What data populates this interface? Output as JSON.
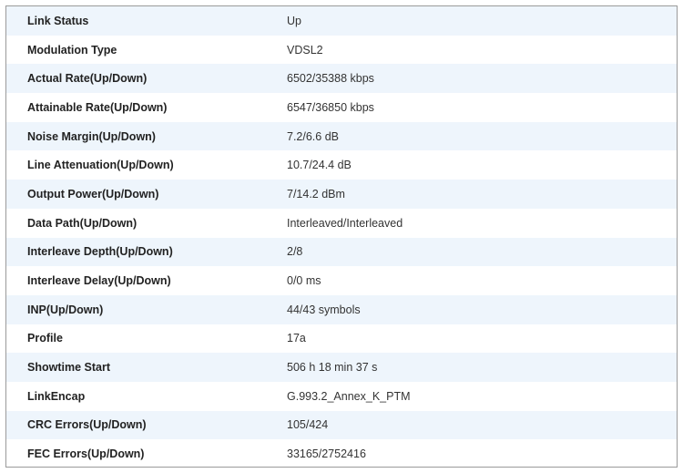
{
  "rows": [
    {
      "label": "Link Status",
      "value": "Up"
    },
    {
      "label": "Modulation Type",
      "value": "VDSL2"
    },
    {
      "label": "Actual Rate(Up/Down)",
      "value": "6502/35388 kbps"
    },
    {
      "label": "Attainable Rate(Up/Down)",
      "value": "6547/36850 kbps"
    },
    {
      "label": "Noise Margin(Up/Down)",
      "value": "7.2/6.6 dB"
    },
    {
      "label": "Line Attenuation(Up/Down)",
      "value": "10.7/24.4 dB"
    },
    {
      "label": "Output Power(Up/Down)",
      "value": "7/14.2 dBm"
    },
    {
      "label": "Data Path(Up/Down)",
      "value": "Interleaved/Interleaved"
    },
    {
      "label": "Interleave Depth(Up/Down)",
      "value": "2/8"
    },
    {
      "label": "Interleave Delay(Up/Down)",
      "value": "0/0 ms"
    },
    {
      "label": "INP(Up/Down)",
      "value": "44/43 symbols"
    },
    {
      "label": "Profile",
      "value": "17a"
    },
    {
      "label": "Showtime Start",
      "value": "506 h 18 min 37 s"
    },
    {
      "label": "LinkEncap",
      "value": "G.993.2_Annex_K_PTM"
    },
    {
      "label": "CRC Errors(Up/Down)",
      "value": "105/424"
    },
    {
      "label": "FEC Errors(Up/Down)",
      "value": "33165/2752416"
    }
  ]
}
